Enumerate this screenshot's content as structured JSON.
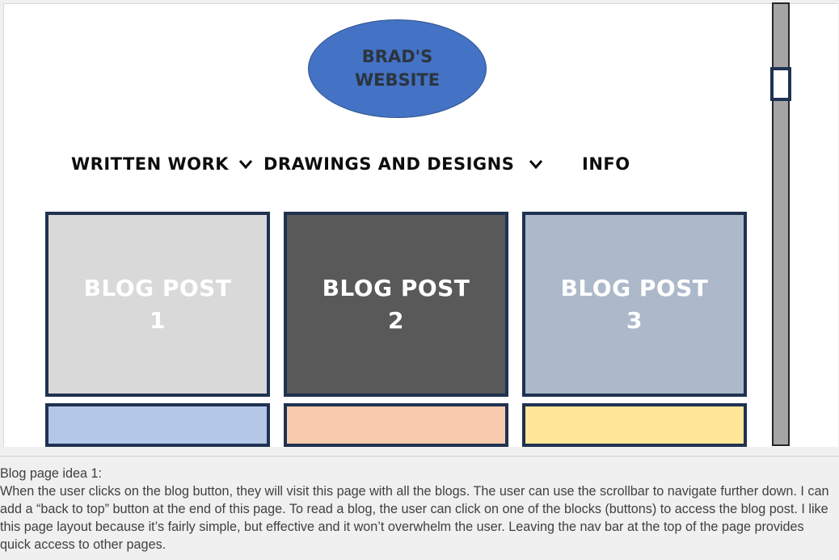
{
  "slide": {
    "logo_text": "BRAD'S\nWEBSITE",
    "nav": [
      {
        "label": "WRITTEN WORK",
        "has_dropdown": true
      },
      {
        "label": "DRAWINGS AND DESIGNS",
        "has_dropdown": true
      },
      {
        "label": "INFO",
        "has_dropdown": false
      }
    ],
    "blog_tiles": [
      {
        "label": "BLOG POST\n1",
        "color": "#d9d9d9"
      },
      {
        "label": "BLOG POST\n2",
        "color": "#595959"
      },
      {
        "label": "BLOG POST\n3",
        "color": "#adb9ca"
      }
    ],
    "lower_tiles": [
      {
        "color": "#b4c7e7"
      },
      {
        "color": "#f8cbad"
      },
      {
        "color": "#ffe699"
      }
    ],
    "scrollbar": {
      "track_color": "#a5a5a5",
      "thumb_color": "#ffffff"
    }
  },
  "notes": {
    "text": "Blog page idea 1:\nWhen the user clicks on the blog button, they will visit this page with all the blogs. The user can use the scrollbar to navigate further down. I can add a “back to top” button at the end of this page. To read a blog, the user can click on one of the blocks (buttons) to access the blog post. I like this page layout because it’s fairly simple, but effective and it won’t overwhelm the user. Leaving the nav bar at the top of the page provides quick access to other pages."
  },
  "colors": {
    "border_navy": "#1f3251",
    "logo_blue": "#4472c4"
  }
}
